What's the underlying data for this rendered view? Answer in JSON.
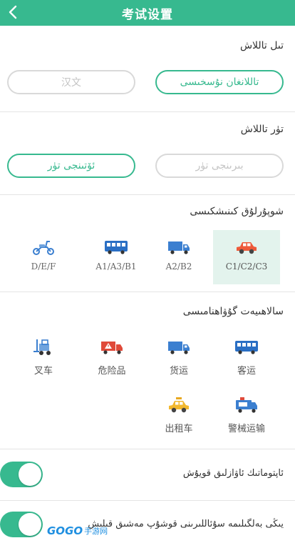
{
  "header": {
    "title": "考试设置",
    "back_icon": "chevron-left-icon",
    "bg_color": "#37b98f"
  },
  "language": {
    "label": "تىل تاللاش",
    "options": [
      {
        "label": "تاللانغان نۇسخىسى",
        "selected": true
      },
      {
        "label": "汉文",
        "selected": false
      }
    ]
  },
  "type": {
    "label": "تۈر تاللاش",
    "options": [
      {
        "label": "بىرىنجى تۈر",
        "selected": false
      },
      {
        "label": "ئۆتىنجى تۈر",
        "selected": true
      }
    ]
  },
  "license": {
    "label": "شوپۇرلۇق كىنىشكىسى",
    "items": [
      {
        "label": "C1/C2/C3",
        "icon": "car-icon",
        "selected": true
      },
      {
        "label": "A2/B2",
        "icon": "truck-icon",
        "selected": false
      },
      {
        "label": "A1/A3/B1",
        "icon": "bus-icon",
        "selected": false
      },
      {
        "label": "D/E/F",
        "icon": "motorcycle-icon",
        "selected": false
      }
    ]
  },
  "qualification": {
    "label": "سالاھىيەت گۇۋاھنامىسى",
    "items": [
      {
        "label": "客运",
        "icon": "bus-icon"
      },
      {
        "label": "货运",
        "icon": "truck-icon"
      },
      {
        "label": "危险品",
        "icon": "hazard-truck-icon"
      },
      {
        "label": "叉车",
        "icon": "forklift-icon"
      },
      {
        "label": "警械运输",
        "icon": "police-van-icon"
      },
      {
        "label": "出租车",
        "icon": "taxi-icon"
      }
    ]
  },
  "toggles": [
    {
      "label": "ئاپتوماتىك ئاۋازلىق قويۇش",
      "on": true
    },
    {
      "label": "يىڭى بەلگىلىمە سۇئاللىرىنى قوشۇپ مەشىق قىلىش",
      "on": true
    }
  ],
  "watermark": {
    "logo": "GOGO",
    "sub": "手游网"
  },
  "colors": {
    "accent": "#37b98f",
    "selected_tile_bg": "#e3f3ed",
    "inactive_border": "#d9d9d9"
  }
}
